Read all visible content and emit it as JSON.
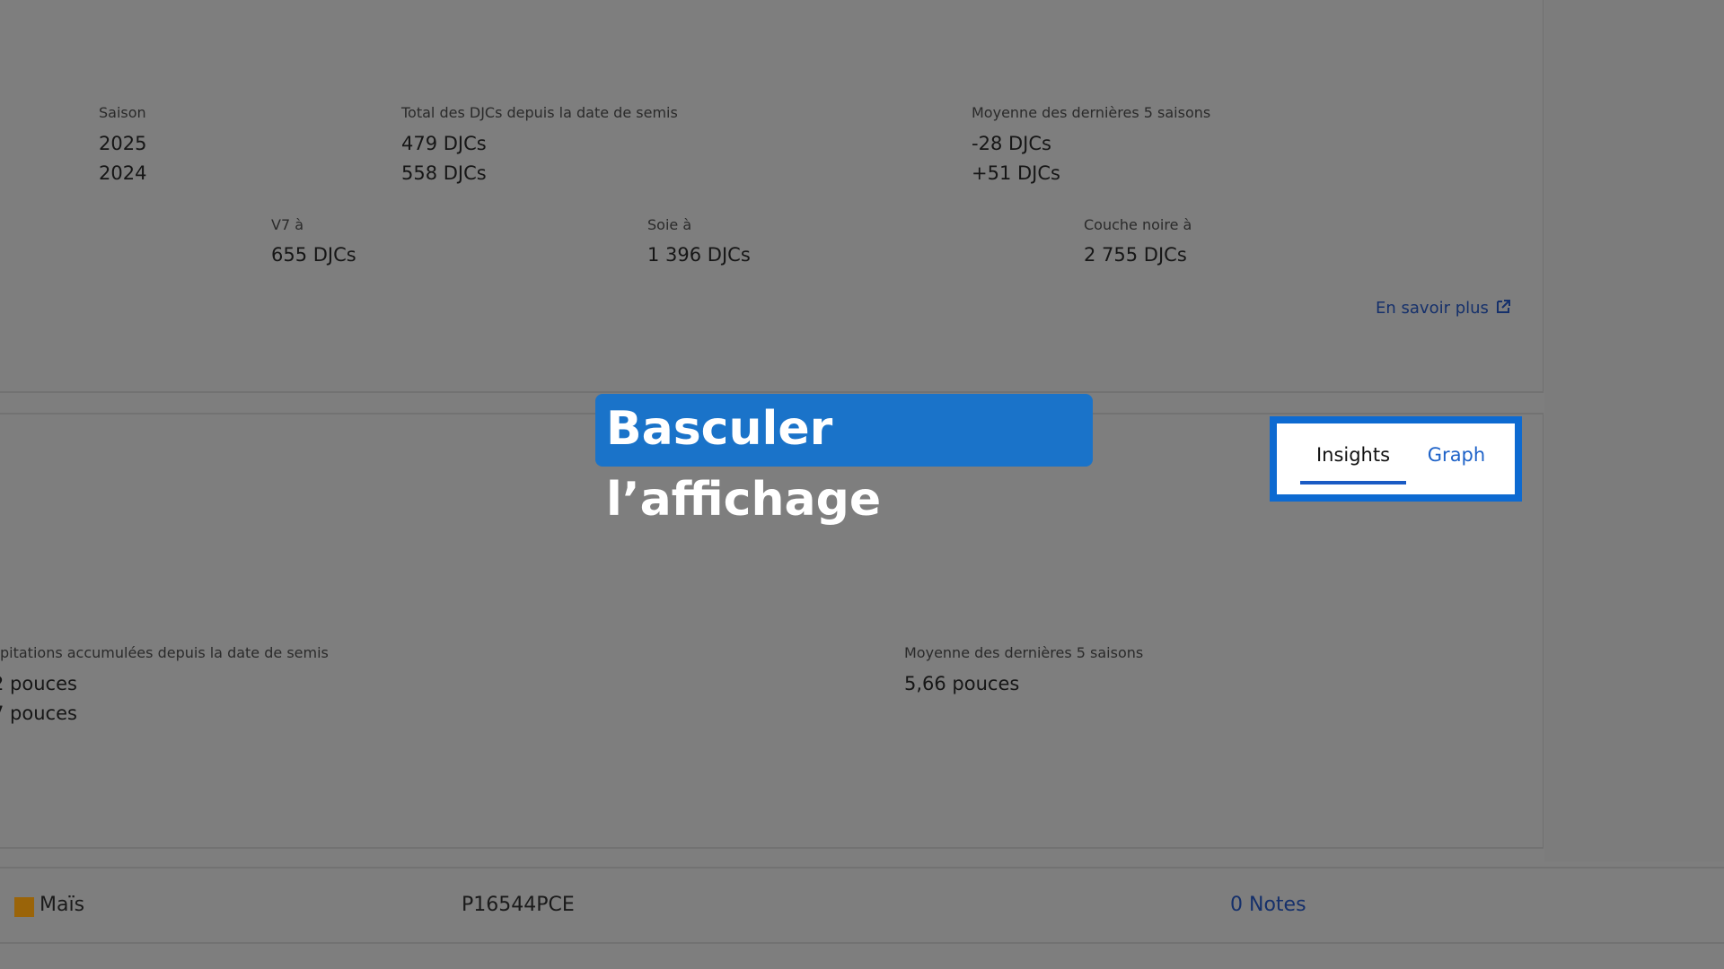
{
  "gdd": {
    "season_label": "Saison",
    "total_label": "Total des DJCs depuis la date de semis",
    "avg_label": "Moyenne des dernières 5 saisons",
    "rows": [
      {
        "season": "2025",
        "total": "479 DJCs",
        "avg": "-28 DJCs"
      },
      {
        "season": "2024",
        "total": "558 DJCs",
        "avg": "+51 DJCs"
      }
    ],
    "stages": [
      {
        "label": "V7 à",
        "value": "655 DJCs"
      },
      {
        "label": "Soie à",
        "value": "1 396 DJCs"
      },
      {
        "label": "Couche noire à",
        "value": "2 755 DJCs"
      }
    ],
    "learn_more": "En savoir plus"
  },
  "callout": {
    "text": "Basculer l’affichage"
  },
  "view_toggle": {
    "tabs": [
      {
        "label": "Insights",
        "active": true
      },
      {
        "label": "Graph",
        "active": false
      }
    ]
  },
  "precip": {
    "total_label": "pitations accumulées depuis la date de semis",
    "values": [
      "2 pouces",
      "7 pouces"
    ],
    "avg_label": "Moyenne des dernières 5 saisons",
    "avg_value": "5,66 pouces"
  },
  "field_row": {
    "crop": "Maïs",
    "crop_color": "#9a6409",
    "field_id": "P16544PCE",
    "notes": "0 Notes"
  },
  "colors": {
    "overlay": "#7e7e7e",
    "callout": "#1a73c9",
    "highlight_border": "#0d6ad1",
    "link": "#15306b"
  }
}
